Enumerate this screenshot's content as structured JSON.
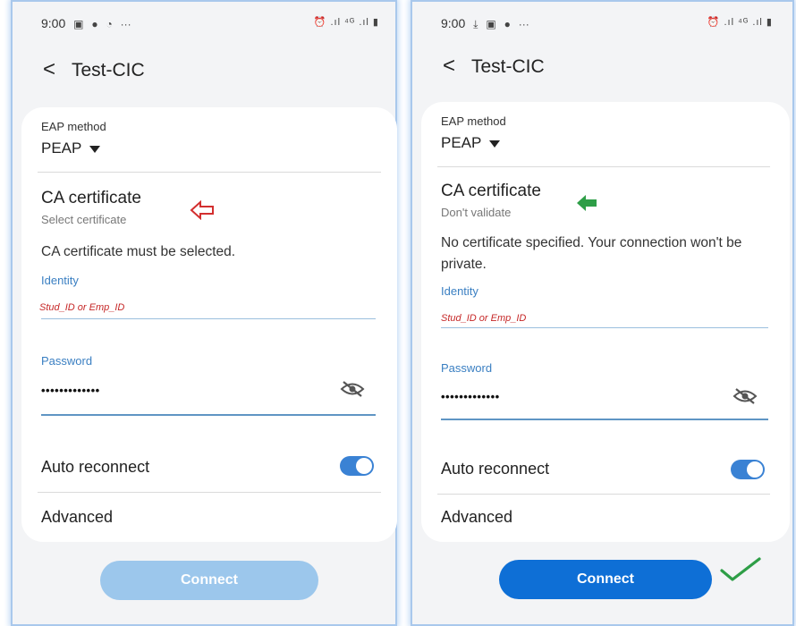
{
  "left": {
    "status_time": "9:00",
    "status_icons": [
      "gallery-icon",
      "facebook-icon",
      "timer-icon",
      "more-icon"
    ],
    "status_more": "···",
    "title": "Test-CIC",
    "eap_label": "EAP method",
    "eap_value": "PEAP",
    "ca_title": "CA certificate",
    "ca_sub": "Select certificate",
    "warning": "CA certificate must be selected.",
    "identity_label": "Identity",
    "identity_hint": "Stud_ID or Emp_ID",
    "password_label": "Password",
    "password_value": "•••••••••••••",
    "auto_reconnect": "Auto reconnect",
    "auto_reconnect_on": true,
    "advanced": "Advanced",
    "connect": "Connect",
    "connect_color": "#9cc7ec",
    "annotation_icon": "outline-left-arrow-icon",
    "annotation_color": "#d32f2f"
  },
  "right": {
    "status_time": "9:00",
    "status_icons": [
      "download-icon",
      "gallery-icon",
      "facebook-icon",
      "more-icon"
    ],
    "status_more": "···",
    "title": "Test-CIC",
    "eap_label": "EAP method",
    "eap_value": "PEAP",
    "ca_title": "CA certificate",
    "ca_sub": "Don't validate",
    "warning": "No certificate specified. Your connection won't be private.",
    "identity_label": "Identity",
    "identity_hint": "Stud_ID or Emp_ID",
    "password_label": "Password",
    "password_value": "•••••••••••••",
    "auto_reconnect": "Auto reconnect",
    "auto_reconnect_on": true,
    "advanced": "Advanced",
    "connect": "Connect",
    "connect_color": "#0e6fd6",
    "annotation_icon": "filled-left-arrow-icon",
    "annotation_color": "#2e9e47",
    "check_icon": "green-checkmark-icon",
    "check_color": "#2e9e47"
  },
  "status_right_text": "⏰ .ıl ⁴ᴳ .ıl ▮",
  "colors": {
    "background": "#f3f4f6",
    "card": "#ffffff",
    "accent": "#3a7fc2",
    "hint_red": "#c62828"
  }
}
